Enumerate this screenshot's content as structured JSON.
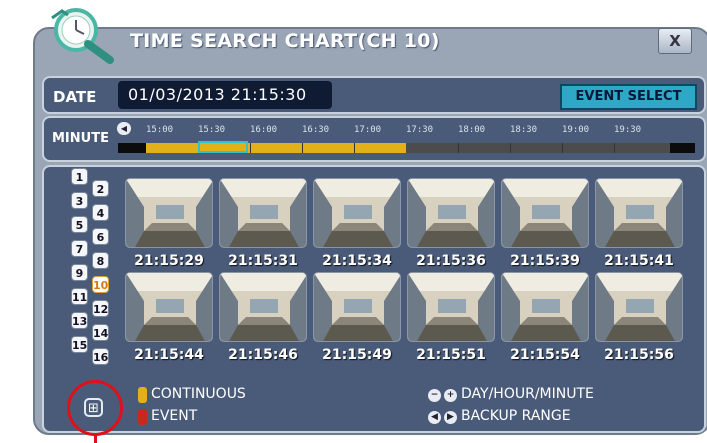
{
  "window": {
    "title": "TIME SEARCH CHART(CH 10)",
    "close_label": "X"
  },
  "date": {
    "label": "DATE",
    "value": "01/03/2013 21:15:30"
  },
  "event_select_label": "EVENT SELECT",
  "minute": {
    "label": "MINUTE",
    "prev_icon": "rewind-icon",
    "ticks": [
      "15:00",
      "15:30",
      "16:00",
      "16:30",
      "17:00",
      "17:30",
      "18:00",
      "18:30",
      "19:00",
      "19:30"
    ],
    "recorded_type": "continuous"
  },
  "channels": [
    "1",
    "2",
    "3",
    "4",
    "5",
    "6",
    "7",
    "8",
    "9",
    "10",
    "11",
    "12",
    "13",
    "14",
    "15",
    "16"
  ],
  "selected_channel": "10",
  "thumbnails": [
    "21:15:29",
    "21:15:31",
    "21:15:34",
    "21:15:36",
    "21:15:39",
    "21:15:41",
    "21:15:44",
    "21:15:46",
    "21:15:49",
    "21:15:51",
    "21:15:54",
    "21:15:56"
  ],
  "legend": {
    "continuous": "CONTINUOUS",
    "event": "EVENT",
    "day_hour_minute": "DAY/HOUR/MINUTE",
    "backup_range": "BACKUP RANGE"
  },
  "colors": {
    "continuous": "#e2b018",
    "event": "#c8281f",
    "selection": "#2ec2d2",
    "annotation": "#e0101a"
  }
}
